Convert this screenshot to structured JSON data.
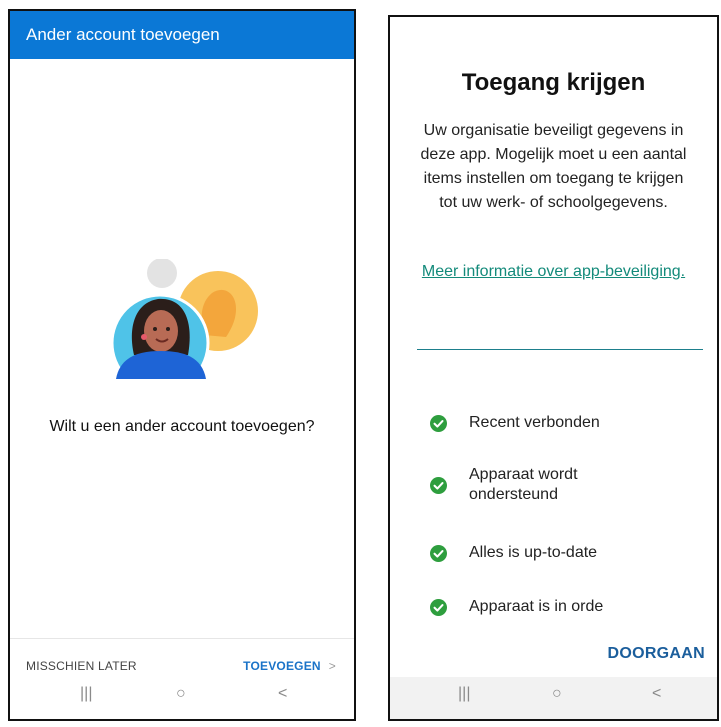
{
  "left_screen": {
    "appbar": {
      "title": "Ander account toevoegen"
    },
    "prompt": "Wilt u een ander account toevoegen?",
    "footer": {
      "later_label": "MISSCHIEN LATER",
      "add_label": "TOEVOEGEN",
      "add_icon": "chevron-right-icon"
    },
    "navbar": {
      "recents": "|||",
      "home": "○",
      "back": "<"
    },
    "colors": {
      "appbar": "#0b78d6",
      "accent": "#1a73c8"
    }
  },
  "right_screen": {
    "title": "Toegang krijgen",
    "description": "Uw organisatie beveiligt gegevens in deze app. Mogelijk moet u een aantal items instellen om toegang te krijgen tot uw werk- of schoolgegevens.",
    "link": "Meer informatie over app-beveiliging.",
    "checks": [
      {
        "label": "Recent verbonden",
        "icon": "check-circle-icon"
      },
      {
        "label": "Apparaat wordt ondersteund",
        "icon": "check-circle-icon"
      },
      {
        "label": "Alles is up-to-date",
        "icon": "check-circle-icon"
      },
      {
        "label": "Apparaat is in orde",
        "icon": "check-circle-icon"
      }
    ],
    "continue_label": "DOORGAAN",
    "navbar": {
      "recents": "|||",
      "home": "○",
      "back": "<"
    },
    "colors": {
      "check": "#2e9e3e",
      "link": "#138a7a",
      "continue": "#1b5e9c"
    }
  }
}
